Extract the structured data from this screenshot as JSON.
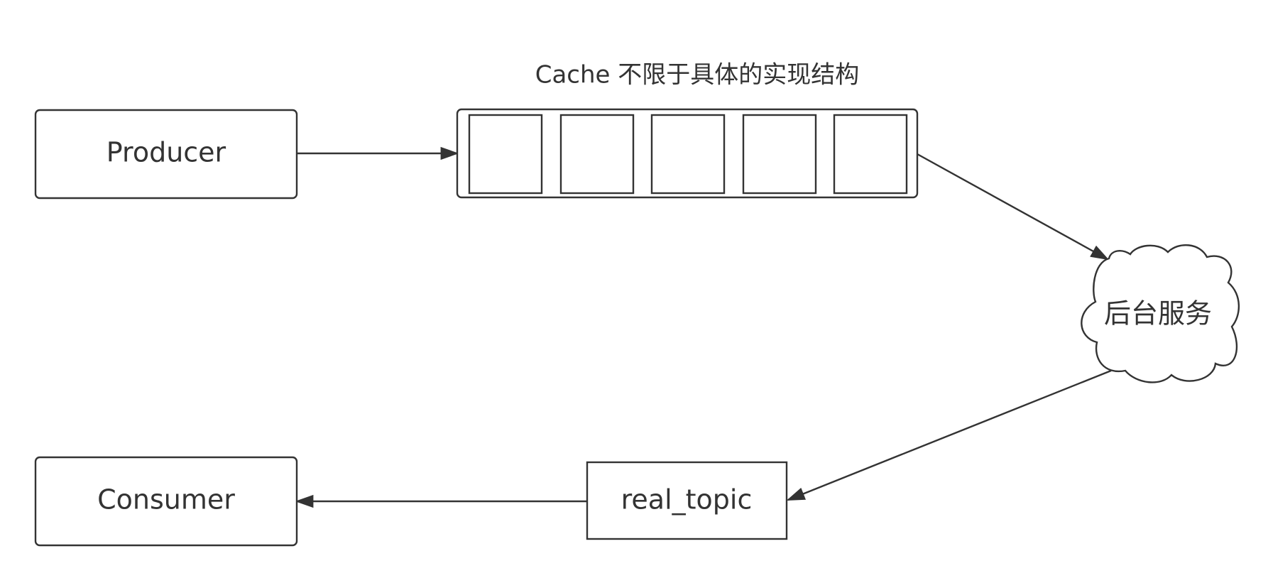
{
  "nodes": {
    "producer": {
      "label": "Producer"
    },
    "cache": {
      "title": "Cache 不限于具体的实现结构",
      "slots": 5
    },
    "backend": {
      "label": "后台服务"
    },
    "real_topic": {
      "label": "real_topic"
    },
    "consumer": {
      "label": "Consumer"
    }
  },
  "edges": [
    {
      "from": "producer",
      "to": "cache"
    },
    {
      "from": "cache",
      "to": "backend"
    },
    {
      "from": "backend",
      "to": "real_topic"
    },
    {
      "from": "real_topic",
      "to": "consumer"
    }
  ],
  "colors": {
    "stroke": "#333333",
    "fill": "#ffffff",
    "text": "#333333"
  }
}
